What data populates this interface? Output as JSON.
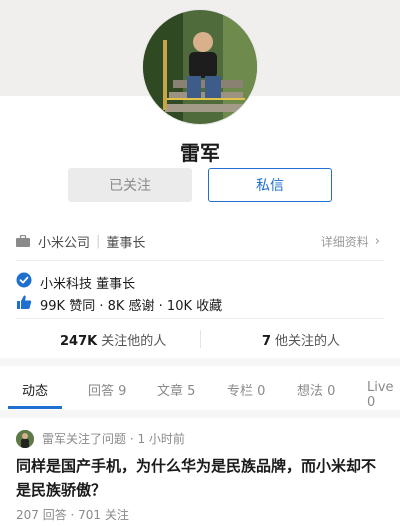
{
  "profile": {
    "name": "雷军",
    "followed_label": "已关注",
    "message_label": "私信"
  },
  "company_row": {
    "company": "小米公司",
    "separator": "|",
    "position": "董事长",
    "detail_label": "详细资料",
    "detail_chevron": "›",
    "icon": "briefcase-icon"
  },
  "verification": {
    "text": "小米科技 董事长",
    "icon": "verified-check-icon",
    "icon_color": "#1f6fd1"
  },
  "achievements": {
    "text": "99K 赞同 · 8K 感谢 · 10K 收藏",
    "icon": "thumbs-up-icon"
  },
  "follow": {
    "followers_count": "247K",
    "followers_label": "关注他的人",
    "following_count": "7",
    "following_label": "他关注的人"
  },
  "tabs": [
    {
      "label": "动态",
      "active": true
    },
    {
      "label": "回答 9"
    },
    {
      "label": "文章 5"
    },
    {
      "label": "专栏 0"
    },
    {
      "label": "想法 0"
    },
    {
      "label": "Live 0"
    }
  ],
  "feed": {
    "meta": "雷军关注了问题 · 1 小时前",
    "title": "同样是国产手机，为什么华为是民族品牌，而小米却不是民族骄傲？",
    "stats": "207 回答 · 701 关注"
  },
  "colors": {
    "accent": "#1f6fd1",
    "background": "#f6f6f6"
  }
}
